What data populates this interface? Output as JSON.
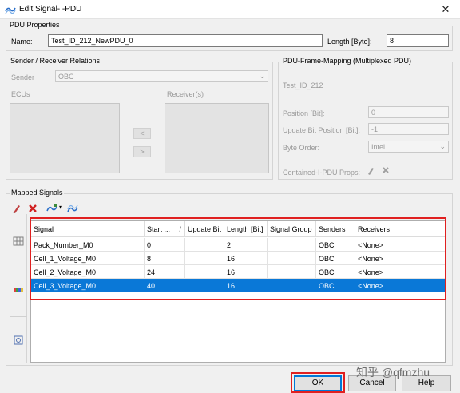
{
  "window": {
    "title": "Edit Signal-I-PDU",
    "close": "✕"
  },
  "pdu_properties": {
    "legend": "PDU Properties",
    "name_label": "Name:",
    "name_value": "Test_ID_212_NewPDU_0",
    "length_label": "Length [Byte]:",
    "length_value": "8"
  },
  "sender_receiver": {
    "legend": "Sender / Receiver Relations",
    "sender_label": "Sender",
    "sender_value": "OBC",
    "ecus_label": "ECUs",
    "receivers_label": "Receiver(s)",
    "left_arrow": "<",
    "right_arrow": ">"
  },
  "frame_mapping": {
    "legend": "PDU-Frame-Mapping (Multiplexed PDU)",
    "frame_name": "Test_ID_212",
    "position_label": "Position [Bit]:",
    "position_value": "0",
    "update_bit_label": "Update Bit Position [Bit]:",
    "update_bit_value": "-1",
    "byte_order_label": "Byte Order:",
    "byte_order_value": "Intel",
    "contained_label": "Contained-I-PDU Props:"
  },
  "mapped_signals": {
    "legend": "Mapped Signals",
    "columns": [
      "Signal",
      "Start ...",
      "Update Bit",
      "Length [Bit]",
      "Signal Group",
      "Senders",
      "Receivers"
    ],
    "rows": [
      {
        "signal": "Pack_Number_M0",
        "start": "0",
        "update_bit": "",
        "length": "2",
        "signal_group": "",
        "senders": "OBC",
        "receivers": "<None>",
        "selected": false
      },
      {
        "signal": "Cell_1_Voltage_M0",
        "start": "8",
        "update_bit": "",
        "length": "16",
        "signal_group": "",
        "senders": "OBC",
        "receivers": "<None>",
        "selected": false
      },
      {
        "signal": "Cell_2_Voltage_M0",
        "start": "24",
        "update_bit": "",
        "length": "16",
        "signal_group": "",
        "senders": "OBC",
        "receivers": "<None>",
        "selected": false
      },
      {
        "signal": "Cell_3_Voltage_M0",
        "start": "40",
        "update_bit": "",
        "length": "16",
        "signal_group": "",
        "senders": "OBC",
        "receivers": "<None>",
        "selected": true
      }
    ],
    "sort_indicator": "/"
  },
  "buttons": {
    "ok": "OK",
    "cancel": "Cancel",
    "help": "Help"
  },
  "watermark": "知乎 @qfmzhu",
  "colors": {
    "selection": "#0a78d7",
    "highlight_box": "#e02020",
    "default_button": "#0078d7"
  }
}
